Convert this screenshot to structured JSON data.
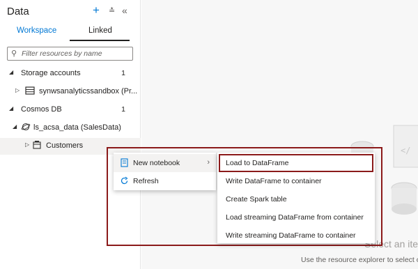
{
  "panel": {
    "title": "Data",
    "tabs": [
      {
        "label": "Workspace"
      },
      {
        "label": "Linked"
      }
    ],
    "filter_placeholder": "Filter resources by name"
  },
  "tree": {
    "storage_accounts": {
      "label": "Storage accounts",
      "count": "1"
    },
    "storage_item": {
      "label": "synwsanalyticssandbox (Pr..."
    },
    "cosmos_db": {
      "label": "Cosmos DB",
      "count": "1"
    },
    "cosmos_item": {
      "label": "ls_acsa_data (SalesData)"
    },
    "container_item": {
      "label": "Customers"
    }
  },
  "context_menu": {
    "items": [
      {
        "label": "New notebook",
        "icon": "notebook-icon"
      },
      {
        "label": "Refresh",
        "icon": "refresh-icon"
      }
    ]
  },
  "submenu": {
    "items": [
      {
        "label": "Load to DataFrame"
      },
      {
        "label": "Write DataFrame to container"
      },
      {
        "label": "Create Spark table"
      },
      {
        "label": "Load streaming DataFrame from container"
      },
      {
        "label": "Write streaming DataFrame to container"
      }
    ]
  },
  "empty_state": {
    "title": "Select an item",
    "subtitle": "Use the resource explorer to select o"
  },
  "colors": {
    "accent": "#0078d4",
    "highlight_outline": "#8b1a1a",
    "selected_background": "#f3f2f1"
  }
}
